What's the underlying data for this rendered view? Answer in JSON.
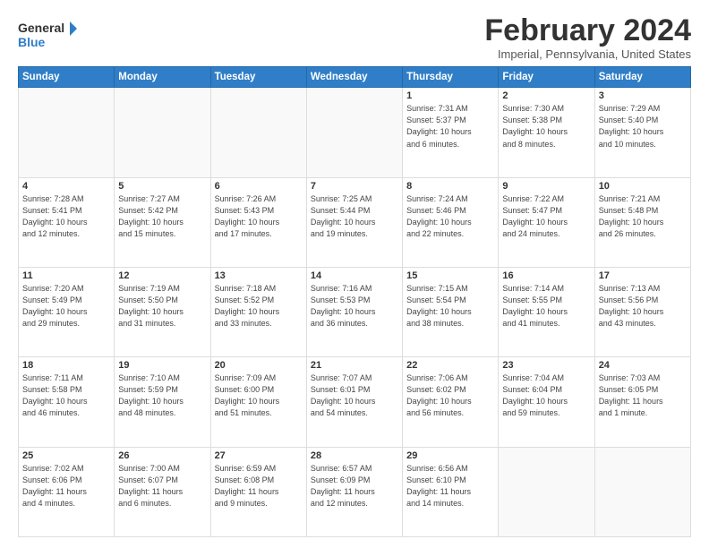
{
  "logo": {
    "line1": "General",
    "line2": "Blue"
  },
  "title": "February 2024",
  "location": "Imperial, Pennsylvania, United States",
  "weekdays": [
    "Sunday",
    "Monday",
    "Tuesday",
    "Wednesday",
    "Thursday",
    "Friday",
    "Saturday"
  ],
  "weeks": [
    [
      {
        "day": "",
        "info": ""
      },
      {
        "day": "",
        "info": ""
      },
      {
        "day": "",
        "info": ""
      },
      {
        "day": "",
        "info": ""
      },
      {
        "day": "1",
        "info": "Sunrise: 7:31 AM\nSunset: 5:37 PM\nDaylight: 10 hours\nand 6 minutes."
      },
      {
        "day": "2",
        "info": "Sunrise: 7:30 AM\nSunset: 5:38 PM\nDaylight: 10 hours\nand 8 minutes."
      },
      {
        "day": "3",
        "info": "Sunrise: 7:29 AM\nSunset: 5:40 PM\nDaylight: 10 hours\nand 10 minutes."
      }
    ],
    [
      {
        "day": "4",
        "info": "Sunrise: 7:28 AM\nSunset: 5:41 PM\nDaylight: 10 hours\nand 12 minutes."
      },
      {
        "day": "5",
        "info": "Sunrise: 7:27 AM\nSunset: 5:42 PM\nDaylight: 10 hours\nand 15 minutes."
      },
      {
        "day": "6",
        "info": "Sunrise: 7:26 AM\nSunset: 5:43 PM\nDaylight: 10 hours\nand 17 minutes."
      },
      {
        "day": "7",
        "info": "Sunrise: 7:25 AM\nSunset: 5:44 PM\nDaylight: 10 hours\nand 19 minutes."
      },
      {
        "day": "8",
        "info": "Sunrise: 7:24 AM\nSunset: 5:46 PM\nDaylight: 10 hours\nand 22 minutes."
      },
      {
        "day": "9",
        "info": "Sunrise: 7:22 AM\nSunset: 5:47 PM\nDaylight: 10 hours\nand 24 minutes."
      },
      {
        "day": "10",
        "info": "Sunrise: 7:21 AM\nSunset: 5:48 PM\nDaylight: 10 hours\nand 26 minutes."
      }
    ],
    [
      {
        "day": "11",
        "info": "Sunrise: 7:20 AM\nSunset: 5:49 PM\nDaylight: 10 hours\nand 29 minutes."
      },
      {
        "day": "12",
        "info": "Sunrise: 7:19 AM\nSunset: 5:50 PM\nDaylight: 10 hours\nand 31 minutes."
      },
      {
        "day": "13",
        "info": "Sunrise: 7:18 AM\nSunset: 5:52 PM\nDaylight: 10 hours\nand 33 minutes."
      },
      {
        "day": "14",
        "info": "Sunrise: 7:16 AM\nSunset: 5:53 PM\nDaylight: 10 hours\nand 36 minutes."
      },
      {
        "day": "15",
        "info": "Sunrise: 7:15 AM\nSunset: 5:54 PM\nDaylight: 10 hours\nand 38 minutes."
      },
      {
        "day": "16",
        "info": "Sunrise: 7:14 AM\nSunset: 5:55 PM\nDaylight: 10 hours\nand 41 minutes."
      },
      {
        "day": "17",
        "info": "Sunrise: 7:13 AM\nSunset: 5:56 PM\nDaylight: 10 hours\nand 43 minutes."
      }
    ],
    [
      {
        "day": "18",
        "info": "Sunrise: 7:11 AM\nSunset: 5:58 PM\nDaylight: 10 hours\nand 46 minutes."
      },
      {
        "day": "19",
        "info": "Sunrise: 7:10 AM\nSunset: 5:59 PM\nDaylight: 10 hours\nand 48 minutes."
      },
      {
        "day": "20",
        "info": "Sunrise: 7:09 AM\nSunset: 6:00 PM\nDaylight: 10 hours\nand 51 minutes."
      },
      {
        "day": "21",
        "info": "Sunrise: 7:07 AM\nSunset: 6:01 PM\nDaylight: 10 hours\nand 54 minutes."
      },
      {
        "day": "22",
        "info": "Sunrise: 7:06 AM\nSunset: 6:02 PM\nDaylight: 10 hours\nand 56 minutes."
      },
      {
        "day": "23",
        "info": "Sunrise: 7:04 AM\nSunset: 6:04 PM\nDaylight: 10 hours\nand 59 minutes."
      },
      {
        "day": "24",
        "info": "Sunrise: 7:03 AM\nSunset: 6:05 PM\nDaylight: 11 hours\nand 1 minute."
      }
    ],
    [
      {
        "day": "25",
        "info": "Sunrise: 7:02 AM\nSunset: 6:06 PM\nDaylight: 11 hours\nand 4 minutes."
      },
      {
        "day": "26",
        "info": "Sunrise: 7:00 AM\nSunset: 6:07 PM\nDaylight: 11 hours\nand 6 minutes."
      },
      {
        "day": "27",
        "info": "Sunrise: 6:59 AM\nSunset: 6:08 PM\nDaylight: 11 hours\nand 9 minutes."
      },
      {
        "day": "28",
        "info": "Sunrise: 6:57 AM\nSunset: 6:09 PM\nDaylight: 11 hours\nand 12 minutes."
      },
      {
        "day": "29",
        "info": "Sunrise: 6:56 AM\nSunset: 6:10 PM\nDaylight: 11 hours\nand 14 minutes."
      },
      {
        "day": "",
        "info": ""
      },
      {
        "day": "",
        "info": ""
      }
    ]
  ]
}
